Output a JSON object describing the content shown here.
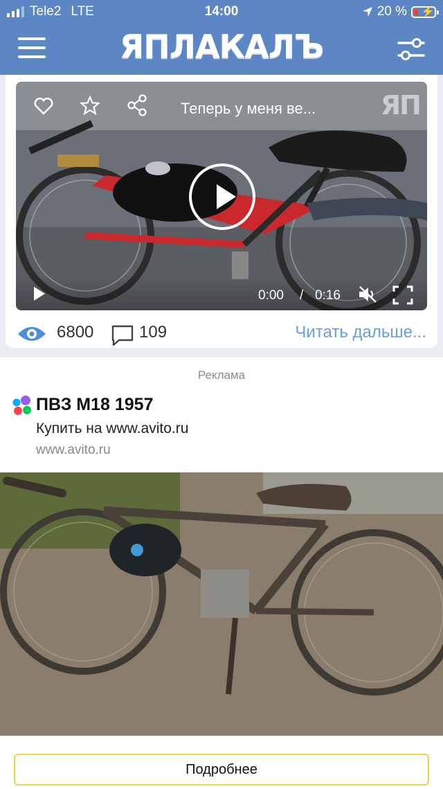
{
  "status_bar": {
    "carrier": "Tele2",
    "network": "LTE",
    "time": "14:00",
    "battery": "20 %"
  },
  "header": {
    "logo": "ЯПЛАКАЛЪ",
    "colors": {
      "bar": "#5c87c4"
    }
  },
  "post": {
    "video_title": "Теперь у меня ве...",
    "watermark": "ЯП",
    "time_current": "0:00",
    "time_separator": "/",
    "time_total": "0:16",
    "views": "6800",
    "comments": "109",
    "read_more": "Читать дальше..."
  },
  "ad": {
    "label": "Реклама",
    "title": "ПВЗ М18 1957",
    "subtitle": "Купить на www.avito.ru",
    "url": "www.avito.ru",
    "button": "Подробнее",
    "colors": {
      "button_border": "#f2d34d",
      "link": "#6a9de0"
    }
  }
}
